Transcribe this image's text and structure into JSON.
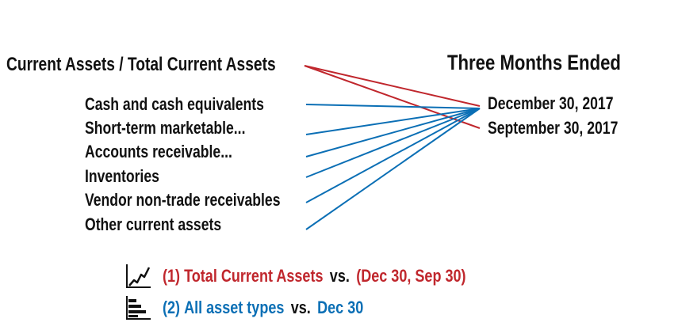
{
  "header": {
    "left_title": "Current Assets / Total Current Assets",
    "right_title": "Three Months Ended"
  },
  "asset_types": [
    "Cash and cash equivalents",
    "Short-term marketable...",
    "Accounts receivable...",
    "Inventories",
    "Vendor non-trade receivables",
    "Other current assets"
  ],
  "periods": [
    "December 30, 2017",
    "September 30, 2017"
  ],
  "legend": [
    {
      "number": "(1)",
      "subject": "Total Current Assets",
      "vs": "vs.",
      "target": "(Dec 30, Sep 30)",
      "color": "#c0272d",
      "icon": "line-chart-icon"
    },
    {
      "number": "(2)",
      "subject": "All asset types",
      "vs": "vs.",
      "target": "Dec 30",
      "color": "#0b6fb5",
      "icon": "bar-chart-icon"
    }
  ],
  "colors": {
    "total_link": "#c0272d",
    "asset_link": "#0b6fb5",
    "text": "#111111"
  }
}
